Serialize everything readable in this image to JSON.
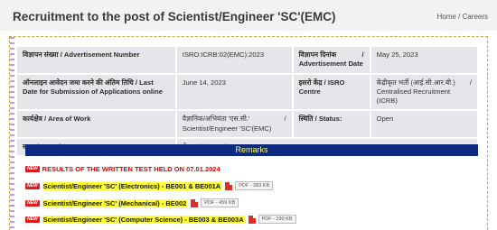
{
  "header": {
    "title": "Recruitment to the post of Scientist/Engineer 'SC'(EMC)",
    "breadcrumb": {
      "home": "Home",
      "separator": "/",
      "current": "Careers"
    }
  },
  "details": {
    "row1": {
      "label1": "विज्ञापन संख्या / Advertisement Number",
      "value1": "ISRO:ICRB:02(EMC):2023",
      "label2_hindi": "विज्ञापन दिनांक",
      "label2_sep": "/",
      "label2_en": "Advertisement Date",
      "value2": "May 25, 2023"
    },
    "row2": {
      "label1": "ऑनलाइन आवेदन जमा करने की अंतिम तिथि / Last Date for Submission of Applications online",
      "value1": "June 14, 2023",
      "label2": "इसरो केंद्र / ISRO Centre",
      "value2_hindi": "केंद्रीकृत भर्ती (आई.सी.आर.बी.)",
      "value2_sep": "/",
      "value2_en": "Centralised Recruitment (ICRB)"
    },
    "row3": {
      "label1": "कार्यक्षेत्र / Area of Work",
      "value1_hindi": "वैज्ञानिक/अभियंता 'एस.सी.'",
      "value1_sep": "/",
      "value1_en": "Scientist/Engineer 'SC'(EMC)",
      "label2": "स्थिति / Status:",
      "value2": "Open"
    },
    "row4": {
      "label1": "स्थान / Location:",
      "value1": "बेंगलूरु / Bengaluru"
    }
  },
  "remarks": {
    "title": "Remarks",
    "new_badge": "NEW",
    "items": [
      {
        "text": "RESULTS OF THE WRITTEN TEST HELD ON 07.01.2024"
      },
      {
        "text": "Scientist/Engineer 'SC' (Electronics) - BE001 & BE001A",
        "pdf_size": "PDF - 283 KB"
      },
      {
        "text": "Scientist/Engineer 'SC' (Mechanical) - BE002",
        "pdf_size": "PDF - 459 KB"
      },
      {
        "text": "Scientist/Engineer 'SC' (Computer Science) - BE003 & BE003A",
        "pdf_size": "PDF - 290 KB"
      }
    ]
  },
  "colors": {
    "remarks_bar": "#0d2a80",
    "remarks_title": "#ffff66",
    "highlight": "#ffff33",
    "result_text": "#e00000",
    "row_bg": "#e6e6ea"
  },
  "icons": [
    "new-badge",
    "pdf-icon"
  ]
}
